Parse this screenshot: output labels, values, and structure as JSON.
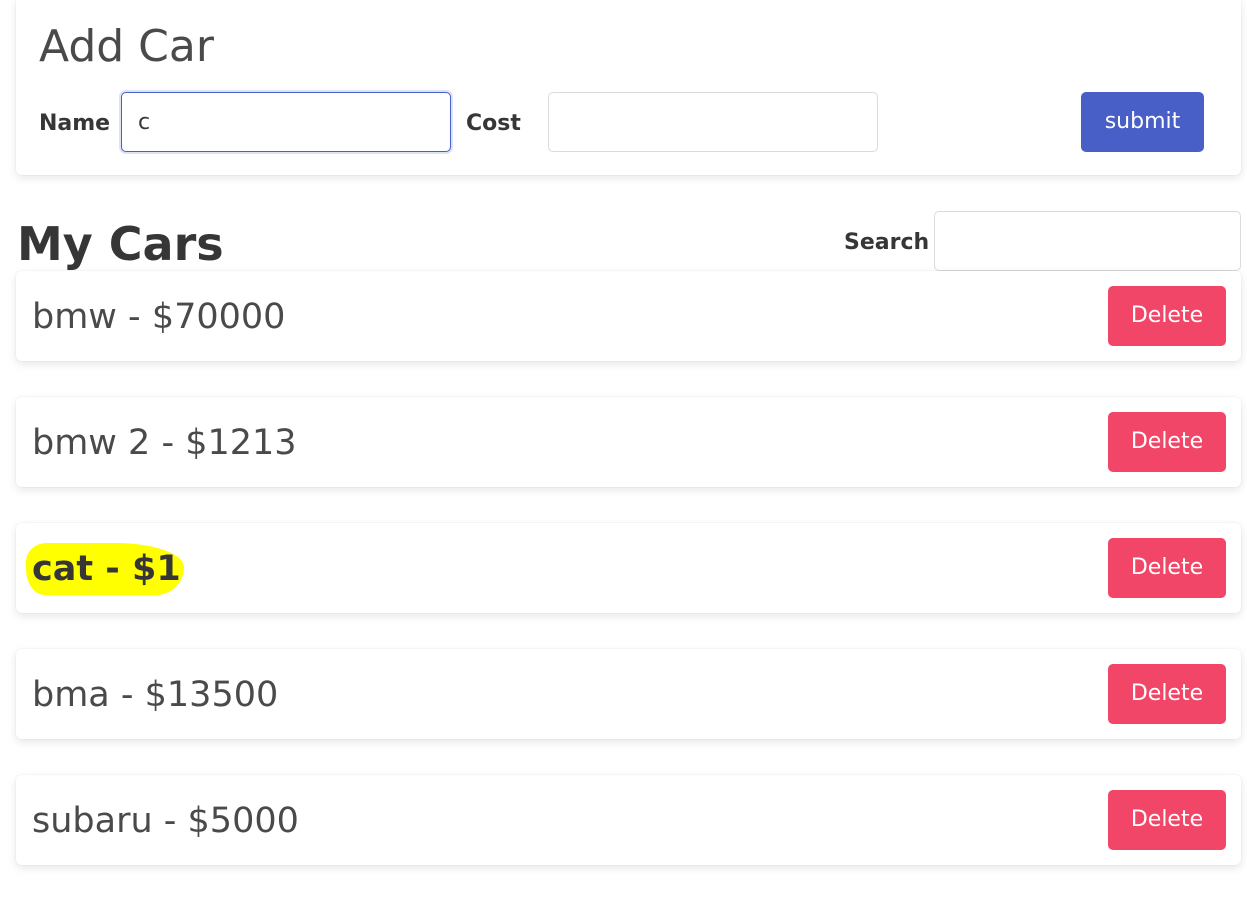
{
  "add_car": {
    "title": "Add Car",
    "name_label": "Name",
    "name_value": "c",
    "cost_label": "Cost",
    "cost_value": "",
    "submit_label": "submit"
  },
  "my_cars": {
    "title": "My Cars",
    "search_label": "Search",
    "search_value": "",
    "items": [
      {
        "text": "bmw - $70000",
        "delete_label": "Delete",
        "highlighted": false
      },
      {
        "text": "bmw 2 - $1213",
        "delete_label": "Delete",
        "highlighted": false
      },
      {
        "text": "cat - $1",
        "delete_label": "Delete",
        "highlighted": true
      },
      {
        "text": "bma - $13500",
        "delete_label": "Delete",
        "highlighted": false
      },
      {
        "text": "subaru - $5000",
        "delete_label": "Delete",
        "highlighted": false
      }
    ]
  },
  "colors": {
    "primary": "#485fc7",
    "danger": "#f14668",
    "highlight": "#ffff00",
    "text": "#363636"
  }
}
